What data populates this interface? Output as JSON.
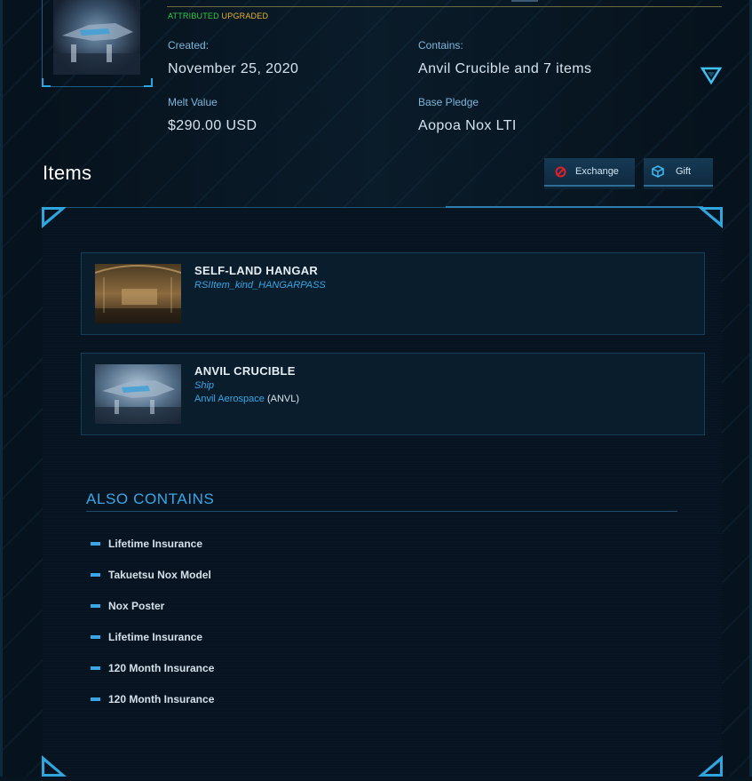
{
  "pledge": {
    "status_attributed": "ATTRIBUTED",
    "status_upgraded": "UPGRADED",
    "created_label": "Created:",
    "created_value": "November 25, 2020",
    "contains_label": "Contains:",
    "contains_value": "Anvil Crucible and 7 items",
    "melt_label": "Melt Value",
    "melt_value": "$290.00 USD",
    "base_label": "Base Pledge",
    "base_value": "Aopoa Nox LTI"
  },
  "items_section": {
    "title": "Items",
    "exchange_label": "Exchange",
    "gift_label": "Gift"
  },
  "items": [
    {
      "name": "SELF-LAND HANGAR",
      "kind": "RSIItem_kind_HANGARPASS",
      "maker": "",
      "maker_code": ""
    },
    {
      "name": "ANVIL CRUCIBLE",
      "kind": "Ship",
      "maker": "Anvil Aerospace",
      "maker_code": "(ANVL)"
    }
  ],
  "also_contains": {
    "title": "ALSO CONTAINS",
    "items": [
      "Lifetime Insurance",
      "Takuetsu Nox Model",
      "Nox Poster",
      "Lifetime Insurance",
      "120 Month Insurance",
      "120 Month Insurance"
    ]
  },
  "colors": {
    "accent": "#3aa6e6",
    "attributed": "#38c84a",
    "upgraded": "#e8b52f",
    "exchange_icon": "#e0202a"
  },
  "icons": {
    "expand": "triangle-down-icon",
    "exchange": "prohibited-icon",
    "gift": "gift-box-icon"
  }
}
